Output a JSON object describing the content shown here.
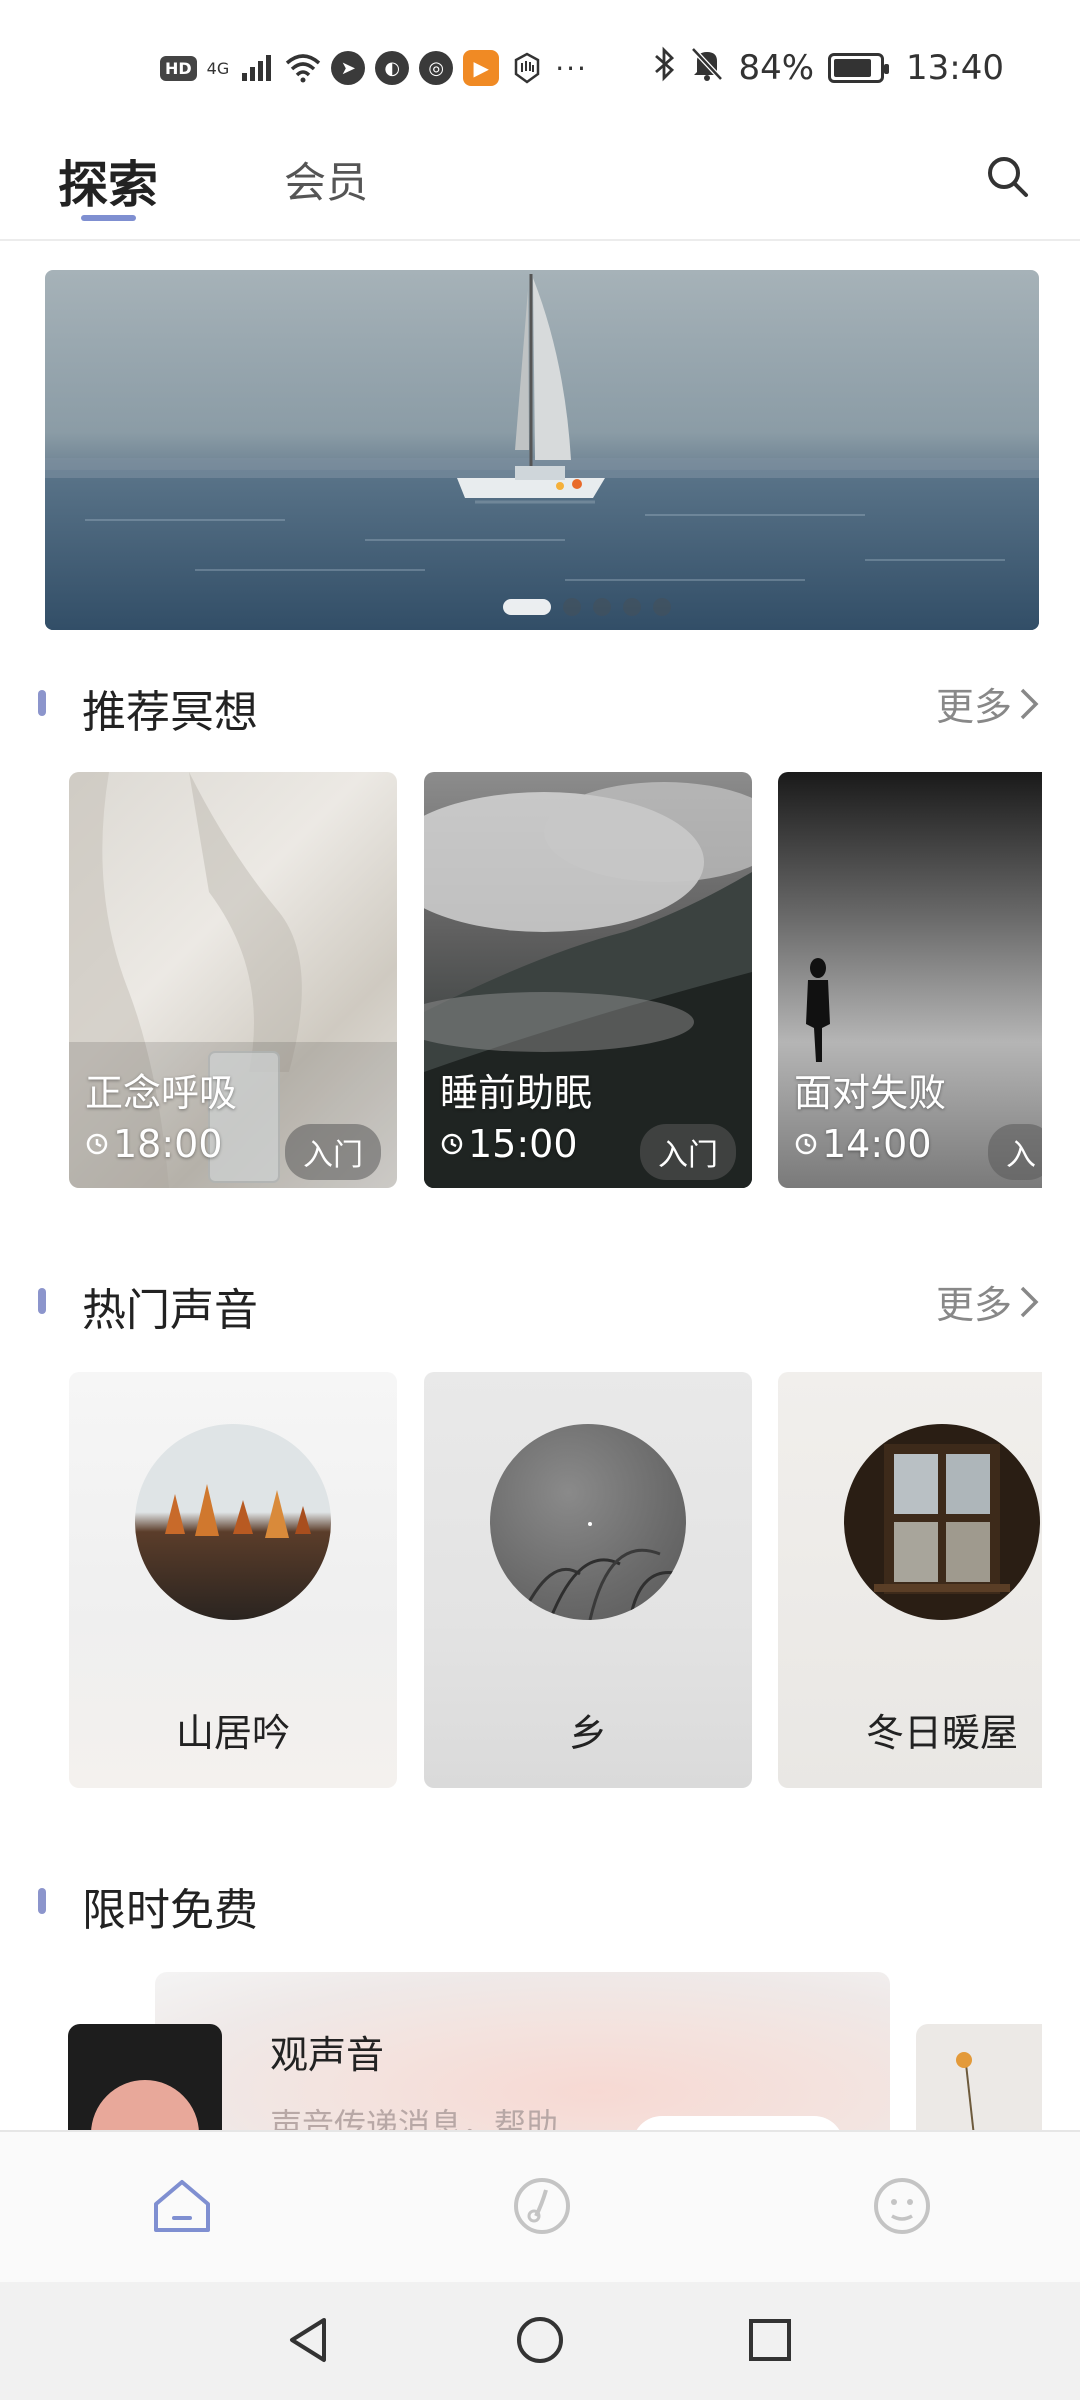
{
  "status_bar": {
    "hd": "HD",
    "network": "4G",
    "more": "···",
    "battery": "84%",
    "battery_level": 0.84,
    "time": "13:40",
    "icons": [
      "hd-icon",
      "signal-icon",
      "wifi-icon",
      "location-icon",
      "app-icon",
      "wechat-icon",
      "video-app-icon",
      "hand-icon",
      "bluetooth-icon",
      "mute-icon",
      "battery-icon"
    ]
  },
  "header": {
    "tabs": [
      {
        "label": "探索",
        "active": true
      },
      {
        "label": "会员",
        "active": false
      }
    ],
    "search_icon": "search-icon"
  },
  "banner": {
    "slide_count": 5,
    "active_index": 0
  },
  "sections": {
    "recommended": {
      "title": "推荐冥想",
      "more": "更多",
      "items": [
        {
          "title": "正念呼吸",
          "time": "18:00",
          "level": "入门"
        },
        {
          "title": "睡前助眠",
          "time": "15:00",
          "level": "入门"
        },
        {
          "title": "面对失败",
          "time": "14:00",
          "level": "入"
        }
      ]
    },
    "popular_sounds": {
      "title": "热门声音",
      "more": "更多",
      "items": [
        {
          "title": "山居吟"
        },
        {
          "title": "乡"
        },
        {
          "title": "冬日暖屋"
        }
      ]
    },
    "free": {
      "title": "限时免费",
      "item_title": "观声音",
      "item_desc": "声音传递消息，帮助"
    }
  },
  "bottom_nav": [
    {
      "icon": "home-icon",
      "active": true
    },
    {
      "icon": "music-note-icon",
      "active": false
    },
    {
      "icon": "profile-face-icon",
      "active": false
    }
  ],
  "colors": {
    "accent": "#7f8fd1",
    "section_bar": "#8c95cc",
    "more_text": "#888888"
  }
}
